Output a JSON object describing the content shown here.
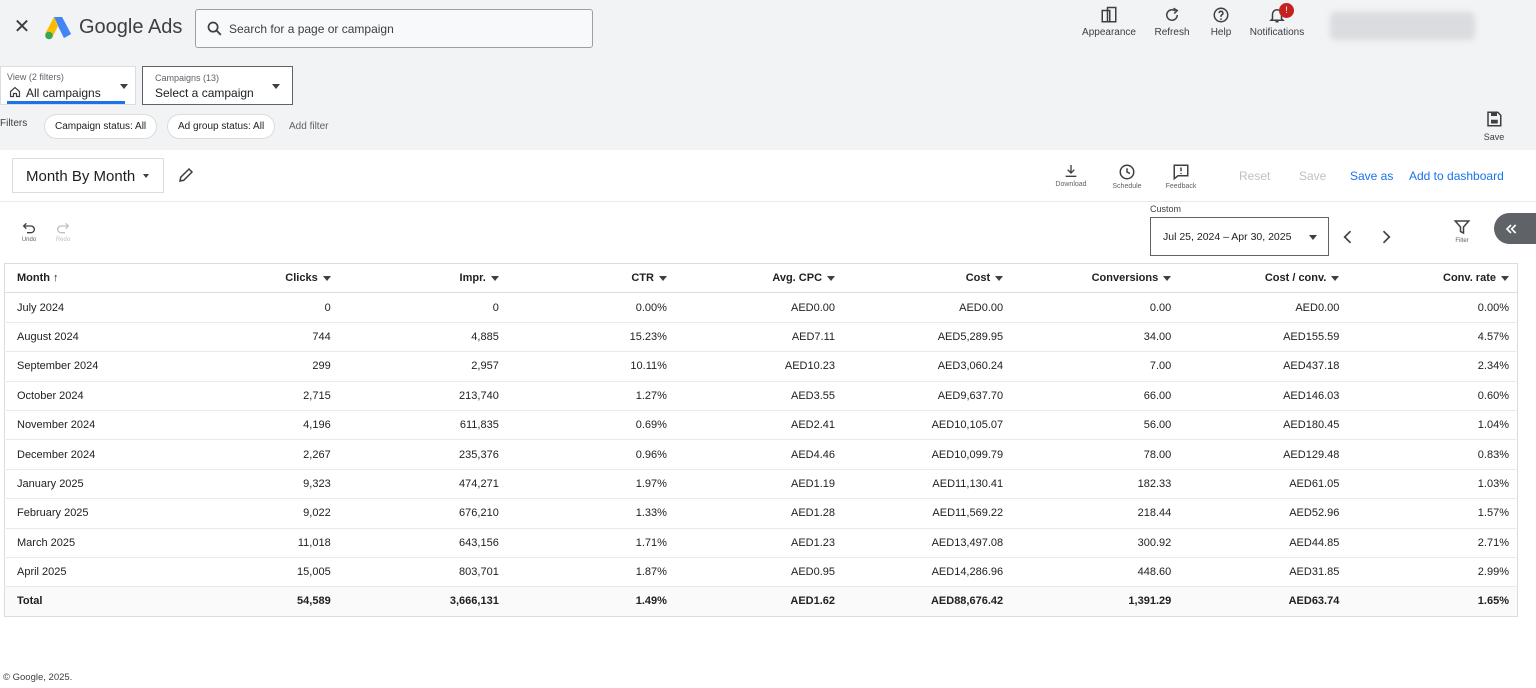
{
  "header": {
    "brand": "Google Ads",
    "search_placeholder": "Search for a page or campaign",
    "tools": [
      {
        "label": "Appearance",
        "icon": "appearance-icon"
      },
      {
        "label": "Refresh",
        "icon": "refresh-icon"
      },
      {
        "label": "Help",
        "icon": "help-icon"
      },
      {
        "label": "Notifications",
        "icon": "bell-icon"
      }
    ],
    "notification_count": "!"
  },
  "selectors": {
    "view_label": "View (2 filters)",
    "view_value": "All campaigns",
    "campaign_label": "Campaigns (13)",
    "campaign_value": "Select a campaign"
  },
  "filters": {
    "label": "Filters",
    "chips": [
      "Campaign status: All",
      "Ad group status: All"
    ],
    "add": "Add filter"
  },
  "top_save": "Save",
  "report": {
    "title": "Month By Month",
    "tools": [
      "Download",
      "Schedule",
      "Feedback"
    ],
    "links": {
      "reset": "Reset",
      "save": "Save",
      "save_as": "Save as",
      "add_dashboard": "Add to dashboard"
    },
    "undo": "Undo",
    "redo": "Redo",
    "custom_label": "Custom",
    "date_range": "Jul 25, 2024 – Apr 30, 2025",
    "filter": "Filter"
  },
  "table": {
    "columns": [
      "Month",
      "Clicks",
      "Impr.",
      "CTR",
      "Avg. CPC",
      "Cost",
      "Conversions",
      "Cost / conv.",
      "Conv. rate"
    ],
    "rows": [
      [
        "July 2024",
        "0",
        "0",
        "0.00%",
        "AED0.00",
        "AED0.00",
        "0.00",
        "AED0.00",
        "0.00%"
      ],
      [
        "August 2024",
        "744",
        "4,885",
        "15.23%",
        "AED7.11",
        "AED5,289.95",
        "34.00",
        "AED155.59",
        "4.57%"
      ],
      [
        "September 2024",
        "299",
        "2,957",
        "10.11%",
        "AED10.23",
        "AED3,060.24",
        "7.00",
        "AED437.18",
        "2.34%"
      ],
      [
        "October 2024",
        "2,715",
        "213,740",
        "1.27%",
        "AED3.55",
        "AED9,637.70",
        "66.00",
        "AED146.03",
        "0.60%"
      ],
      [
        "November 2024",
        "4,196",
        "611,835",
        "0.69%",
        "AED2.41",
        "AED10,105.07",
        "56.00",
        "AED180.45",
        "1.04%"
      ],
      [
        "December 2024",
        "2,267",
        "235,376",
        "0.96%",
        "AED4.46",
        "AED10,099.79",
        "78.00",
        "AED129.48",
        "0.83%"
      ],
      [
        "January 2025",
        "9,323",
        "474,271",
        "1.97%",
        "AED1.19",
        "AED11,130.41",
        "182.33",
        "AED61.05",
        "1.03%"
      ],
      [
        "February 2025",
        "9,022",
        "676,210",
        "1.33%",
        "AED1.28",
        "AED11,569.22",
        "218.44",
        "AED52.96",
        "1.57%"
      ],
      [
        "March 2025",
        "11,018",
        "643,156",
        "1.71%",
        "AED1.23",
        "AED13,497.08",
        "300.92",
        "AED44.85",
        "2.71%"
      ],
      [
        "April 2025",
        "15,005",
        "803,701",
        "1.87%",
        "AED0.95",
        "AED14,286.96",
        "448.60",
        "AED31.85",
        "2.99%"
      ]
    ],
    "total": [
      "Total",
      "54,589",
      "3,666,131",
      "1.49%",
      "AED1.62",
      "AED88,676.42",
      "1,391.29",
      "AED63.74",
      "1.65%"
    ]
  },
  "footer": "© Google, 2025."
}
